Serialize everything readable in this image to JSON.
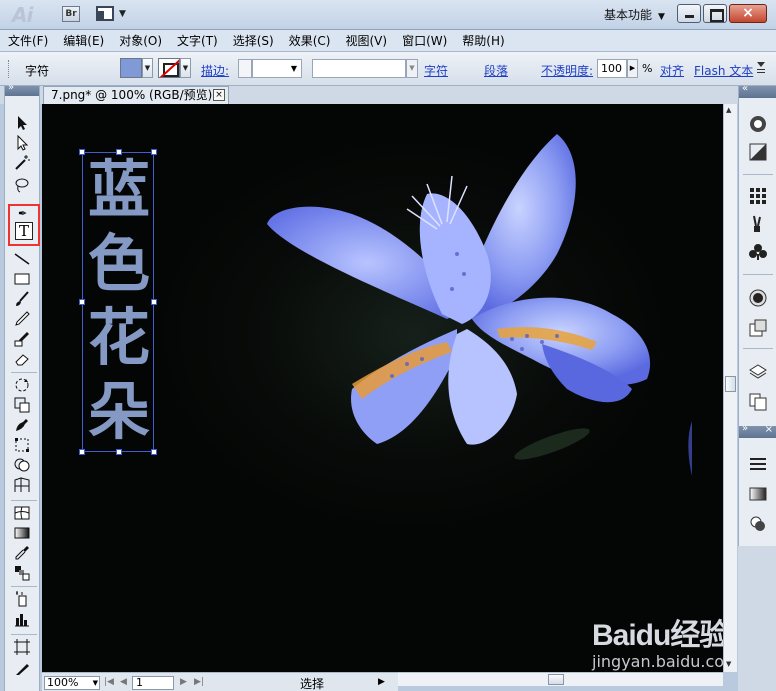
{
  "app": {
    "logo_text": "Ai",
    "bridge_label": "Br",
    "workspace_label": "基本功能",
    "close_label": "×"
  },
  "menu": {
    "items": [
      "文件(F)",
      "编辑(E)",
      "对象(O)",
      "文字(T)",
      "选择(S)",
      "效果(C)",
      "视图(V)",
      "窗口(W)",
      "帮助(H)"
    ]
  },
  "controlbar": {
    "tool_label": "字符",
    "fill_color": "#7f9ad6",
    "stroke_label": "描边:",
    "character_link": "字符",
    "paragraph_link": "段落",
    "opacity_label": "不透明度:",
    "opacity_value": "100",
    "percent": "%",
    "align_link": "对齐",
    "flash_link": "Flash 文本"
  },
  "document": {
    "tab_title": "7.png* @ 100% (RGB/预览)",
    "tab_close": "×",
    "vertical_text": [
      "蓝",
      "色",
      "花",
      "朵"
    ],
    "text_color": "#8499c4",
    "watermark_brand": "Baidu经验",
    "watermark_url": "jingyan.baidu.com"
  },
  "status": {
    "zoom": "100%",
    "page": "1",
    "text": "选择"
  },
  "tools": {
    "active": "type-tool"
  }
}
